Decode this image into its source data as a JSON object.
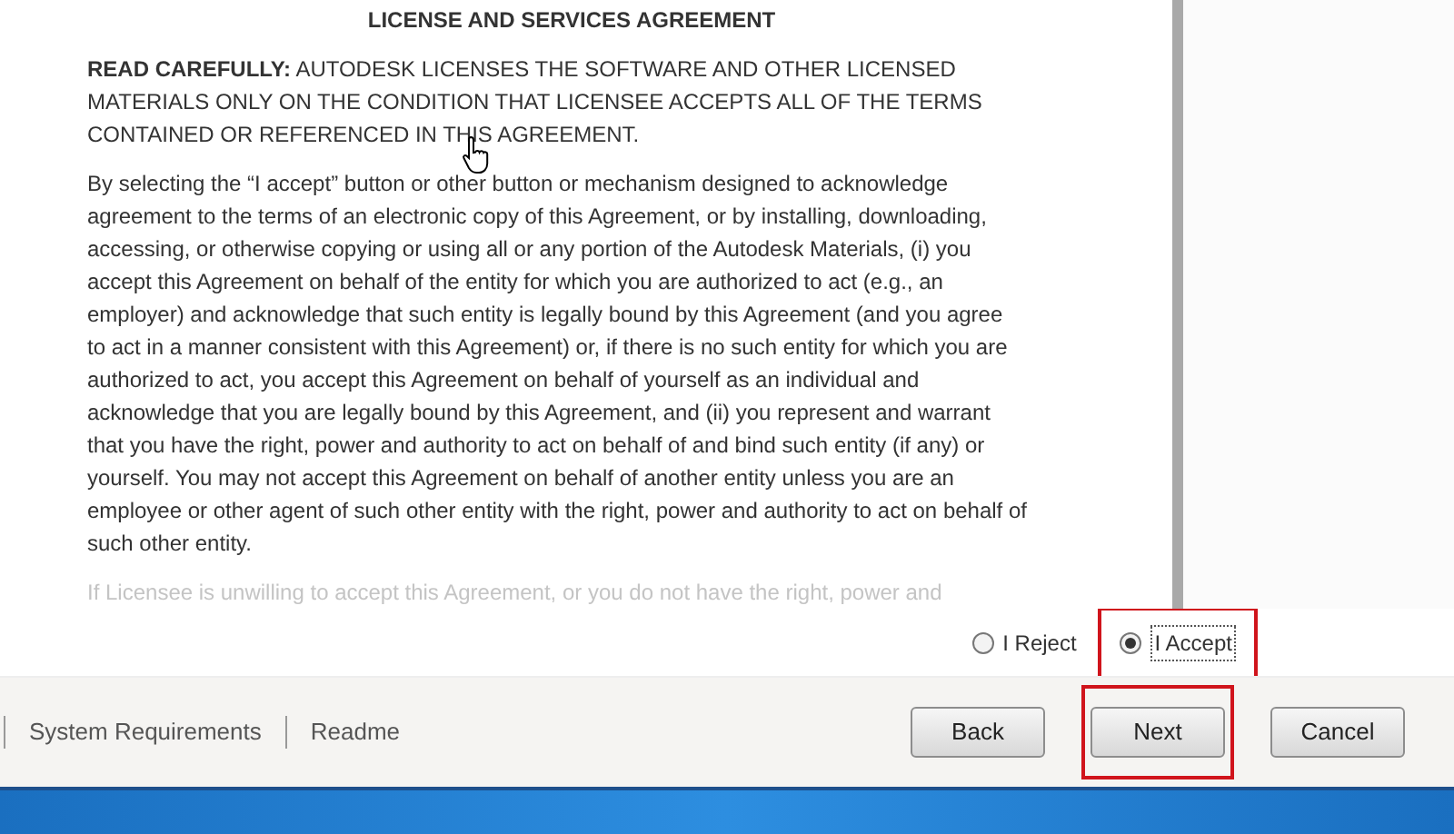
{
  "agreement": {
    "title": "LICENSE AND SERVICES AGREEMENT",
    "paragraphs": [
      {
        "lines": [
          "**READ CAREFULLY:**  AUTODESK LICENSES THE SOFTWARE AND OTHER LICENSED",
          "MATERIALS ONLY ON THE CONDITION THAT LICENSEE ACCEPTS ALL OF THE TERMS",
          "CONTAINED OR REFERENCED IN THIS AGREEMENT."
        ]
      },
      {
        "lines": [
          "By selecting the “I accept” button or other button or mechanism designed to acknowledge",
          "agreement to the terms of an electronic copy of this Agreement, or by installing, downloading,",
          "accessing, or otherwise copying or using all or any portion of the Autodesk Materials, (i) you",
          "accept this Agreement on behalf of the entity for which you are authorized to act (e.g., an",
          "employer) and acknowledge that such entity is legally bound by this Agreement (and you agree",
          "to act in a manner consistent with this Agreement) or, if there is no such entity for which you are",
          "authorized to act, you accept this Agreement on behalf of yourself as an individual and",
          "acknowledge that you are legally bound by this Agreement, and (ii) you represent and warrant",
          "that you have the right, power and authority to act on behalf of and bind such entity (if any) or",
          "yourself.  You may not accept this Agreement on behalf of another entity unless you are an",
          "employee or other agent of such other entity with the right, power and authority to act on behalf of",
          "such other entity."
        ]
      }
    ],
    "faded_line": "If Licensee is unwilling to accept this Agreement, or you do not have the right, power and"
  },
  "choices": [
    {
      "label": "I Reject",
      "selected": false,
      "highlighted": false
    },
    {
      "label": "I Accept",
      "selected": true,
      "highlighted": true
    }
  ],
  "footer_links": [
    "System Requirements",
    "Readme"
  ],
  "buttons": [
    {
      "label": "Back",
      "highlighted": false
    },
    {
      "label": "Next",
      "highlighted": true
    },
    {
      "label": "Cancel",
      "highlighted": false
    }
  ]
}
